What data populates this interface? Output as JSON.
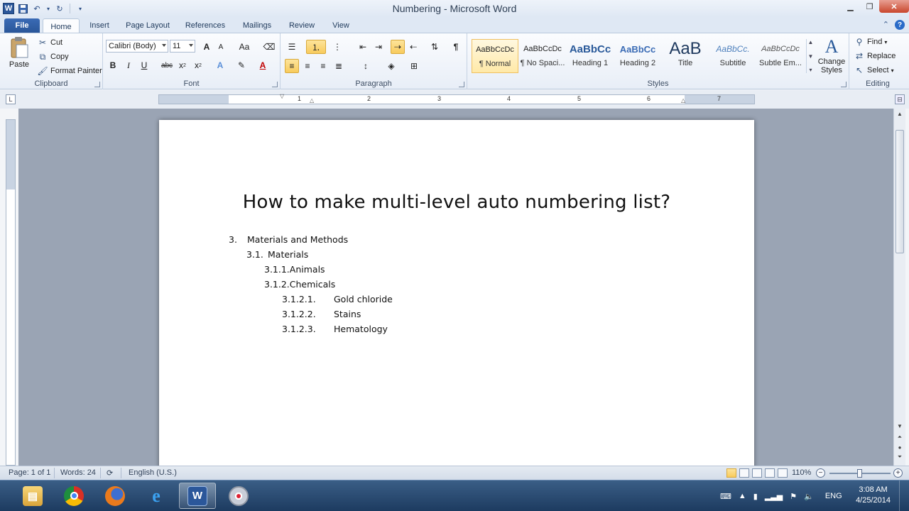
{
  "window": {
    "title": "Numbering  -  Microsoft Word",
    "app_logo": "W",
    "controls": [
      "minimize-icon",
      "restore-icon",
      "close-icon"
    ]
  },
  "tabs": [
    {
      "label": "File"
    },
    {
      "label": "Home"
    },
    {
      "label": "Insert"
    },
    {
      "label": "Page Layout"
    },
    {
      "label": "References"
    },
    {
      "label": "Mailings"
    },
    {
      "label": "Review"
    },
    {
      "label": "View"
    }
  ],
  "ribbon": {
    "clipboard": {
      "label": "Clipboard",
      "paste": "Paste",
      "cut": "Cut",
      "copy": "Copy",
      "format_painter": "Format Painter"
    },
    "font": {
      "label": "Font",
      "font_name": "Calibri (Body)",
      "font_size": "11",
      "grow": "A",
      "shrink": "A",
      "change_case": "Aa",
      "bold": "B",
      "italic": "I",
      "underline": "U",
      "strike": "abc",
      "subscript": "x",
      "superscript": "x",
      "text_effects": "A",
      "font_color": "A"
    },
    "paragraph": {
      "label": "Paragraph",
      "pilcrow": "¶"
    },
    "styles": {
      "label": "Styles",
      "items": [
        {
          "sample": "AaBbCcDc",
          "name": "¶ Normal"
        },
        {
          "sample": "AaBbCcDc",
          "name": "¶ No Spaci..."
        },
        {
          "sample": "AaBbCc",
          "name": "Heading 1"
        },
        {
          "sample": "AaBbCc",
          "name": "Heading 2"
        },
        {
          "sample": "AaB",
          "name": "Title"
        },
        {
          "sample": "AaBbCc.",
          "name": "Subtitle"
        },
        {
          "sample": "AaBbCcDc",
          "name": "Subtle Em..."
        }
      ],
      "change_styles_1": "Change",
      "change_styles_2": "Styles"
    },
    "editing": {
      "label": "Editing",
      "find": "Find",
      "replace": "Replace",
      "select": "Select"
    }
  },
  "ruler": {
    "numbers": [
      "1",
      "1",
      "2",
      "3",
      "4",
      "5",
      "6",
      "7"
    ]
  },
  "document": {
    "title": "How to make multi-level auto numbering list?",
    "items": [
      {
        "num": "3.",
        "text": "Materials and Methods"
      },
      {
        "num": "3.1.",
        "text": "Materials"
      },
      {
        "num": "3.1.1.",
        "text": "Animals"
      },
      {
        "num": "3.1.2.",
        "text": "Chemicals"
      },
      {
        "num": "3.1.2.1.",
        "text": "Gold chloride"
      },
      {
        "num": "3.1.2.2.",
        "text": "Stains"
      },
      {
        "num": "3.1.2.3.",
        "text": "Hematology"
      }
    ]
  },
  "status": {
    "page": "Page: 1 of 1",
    "words": "Words: 24",
    "language": "English (U.S.)",
    "zoom": "110%",
    "zoom_level_percent": 110
  },
  "taskbar": {
    "apps": [
      {
        "name": "explorer-icon",
        "active": false
      },
      {
        "name": "chrome-icon",
        "active": false
      },
      {
        "name": "firefox-icon",
        "active": false
      },
      {
        "name": "ie-icon",
        "active": false
      },
      {
        "name": "word-icon",
        "active": true
      },
      {
        "name": "recorder-icon",
        "active": false
      }
    ],
    "lang": "ENG",
    "time": "3:08 AM",
    "date": "4/25/2014"
  },
  "colors": {
    "accent": "#2b579a",
    "selected_style": "#f8cb5c",
    "taskbar": "#1d3b60"
  }
}
